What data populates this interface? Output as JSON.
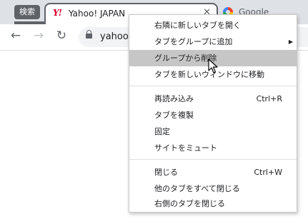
{
  "tab_group": {
    "label": "検索"
  },
  "tabs": [
    {
      "title": "Yahoo! JAPAN",
      "favicon": "Y!"
    },
    {
      "title": "Google"
    }
  ],
  "omnibox": {
    "url": "yahoo"
  },
  "context_menu": {
    "items": [
      {
        "label": "右隣に新しいタブを開く"
      },
      {
        "label": "タブをグループに追加"
      },
      {
        "label": "グループから削除"
      },
      {
        "label": "タブを新しいウィンドウに移動"
      },
      {
        "label": "再読み込み",
        "shortcut": "Ctrl+R"
      },
      {
        "label": "タブを複製"
      },
      {
        "label": "固定"
      },
      {
        "label": "サイトをミュート"
      },
      {
        "label": "閉じる",
        "shortcut": "Ctrl+W"
      },
      {
        "label": "他のタブをすべて閉じる"
      },
      {
        "label": "右側のタブを閉じる"
      }
    ]
  },
  "colors": {
    "tabstrip": "#dee1e6",
    "group": "#5f6368",
    "highlight": "#c6c6c6",
    "yahoo_red": "#d6002c"
  }
}
